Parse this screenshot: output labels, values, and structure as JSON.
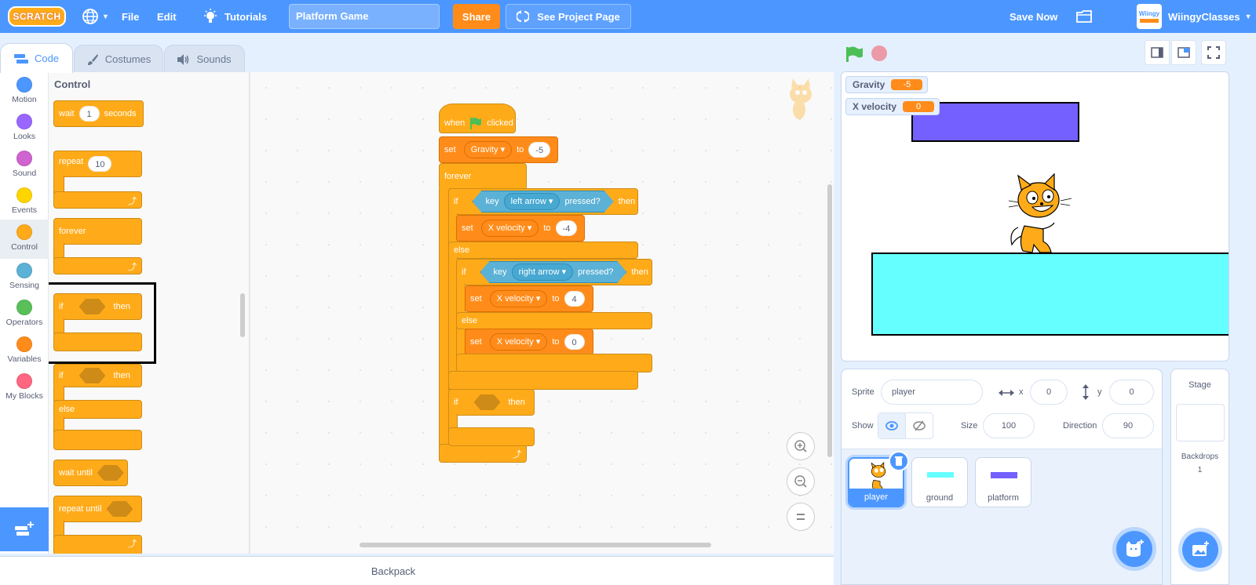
{
  "menubar": {
    "logo": "SCRATCH",
    "file": "File",
    "edit": "Edit",
    "tutorials": "Tutorials",
    "project_title": "Platform Game",
    "share": "Share",
    "see_project_page": "See Project Page",
    "save_now": "Save Now",
    "username": "WiingyClasses",
    "avatar_text": "Wiingy"
  },
  "tabs": [
    {
      "label": "Code",
      "active": true
    },
    {
      "label": "Costumes",
      "active": false
    },
    {
      "label": "Sounds",
      "active": false
    }
  ],
  "categories": [
    {
      "label": "Motion",
      "color": "#4c97ff"
    },
    {
      "label": "Looks",
      "color": "#9966ff"
    },
    {
      "label": "Sound",
      "color": "#cf63cf"
    },
    {
      "label": "Events",
      "color": "#ffd500"
    },
    {
      "label": "Control",
      "color": "#ffab19",
      "active": true
    },
    {
      "label": "Sensing",
      "color": "#5cb1d6"
    },
    {
      "label": "Operators",
      "color": "#59c059"
    },
    {
      "label": "Variables",
      "color": "#ff8c1a"
    },
    {
      "label": "My Blocks",
      "color": "#ff6680"
    }
  ],
  "palette": {
    "title": "Control",
    "blocks": {
      "wait": {
        "label": "wait",
        "value": "1",
        "suffix": "seconds"
      },
      "repeat": {
        "label": "repeat",
        "value": "10"
      },
      "forever": {
        "label": "forever"
      },
      "if_then": {
        "if": "if",
        "then": "then",
        "highlighted": true
      },
      "if_else": {
        "if": "if",
        "then": "then",
        "else": "else"
      },
      "wait_until": {
        "label": "wait until"
      },
      "repeat_until": {
        "label": "repeat until"
      }
    }
  },
  "script": {
    "hat": {
      "when": "when",
      "clicked": "clicked"
    },
    "set_gravity": {
      "set": "set",
      "var": "Gravity",
      "to": "to",
      "value": "-5"
    },
    "forever": "forever",
    "if1": {
      "if": "if",
      "key": "key",
      "key_option": "left arrow",
      "pressed": "pressed?",
      "then": "then"
    },
    "set_xv1": {
      "set": "set",
      "var": "X velocity",
      "to": "to",
      "value": "-4"
    },
    "else1": "else",
    "if2": {
      "if": "if",
      "key": "key",
      "key_option": "right arrow",
      "pressed": "pressed?",
      "then": "then"
    },
    "set_xv2": {
      "set": "set",
      "var": "X velocity",
      "to": "to",
      "value": "4"
    },
    "else2": "else",
    "set_xv3": {
      "set": "set",
      "var": "X velocity",
      "to": "to",
      "value": "0"
    },
    "if3": {
      "if": "if",
      "then": "then"
    }
  },
  "backpack": "Backpack",
  "stage": {
    "monitors": [
      {
        "label": "Gravity",
        "value": "-5"
      },
      {
        "label": "X velocity",
        "value": "0"
      }
    ],
    "colors": {
      "platform": "#7360ff",
      "ground": "#66ffff"
    }
  },
  "sprite_info": {
    "sprite_label": "Sprite",
    "sprite_name": "player",
    "x_label": "x",
    "x": "0",
    "y_label": "y",
    "y": "0",
    "show_label": "Show",
    "size_label": "Size",
    "size": "100",
    "direction_label": "Direction",
    "direction": "90"
  },
  "sprites": [
    {
      "name": "player",
      "selected": true
    },
    {
      "name": "ground",
      "color": "#66ffff"
    },
    {
      "name": "platform",
      "color": "#7360ff"
    }
  ],
  "stage_panel": {
    "title": "Stage",
    "backdrops_label": "Backdrops",
    "backdrops_count": "1"
  }
}
